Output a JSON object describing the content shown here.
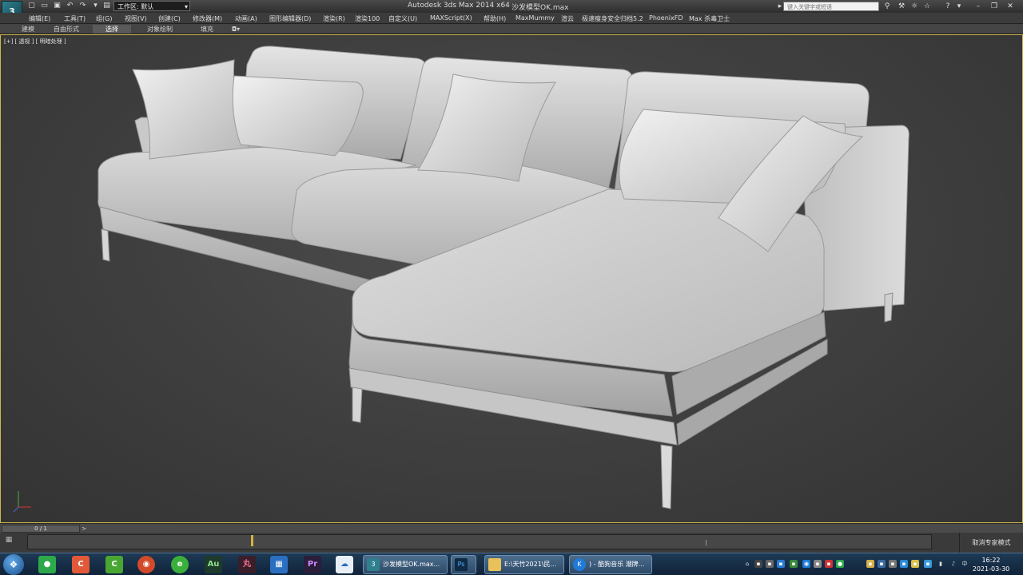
{
  "title_bar": {
    "logo": "3",
    "workspace_label": "工作区: 默认",
    "app_title": "Autodesk 3ds Max  2014 x64",
    "file_title": "沙发模型OK.max",
    "search_placeholder": "键入关键字或短语"
  },
  "menus": [
    "编辑(E)",
    "工具(T)",
    "组(G)",
    "视图(V)",
    "创建(C)",
    "修改器(M)",
    "动画(A)",
    "图形编辑器(D)",
    "渲染(R)",
    "渲染100",
    "自定义(U)",
    "MAXScript(X)",
    "帮助(H)",
    "MaxMummy",
    "渲云",
    "极速瘦身安全归档5.2",
    "PhoenixFD",
    "Max 杀毒卫士"
  ],
  "ribbon_tabs": [
    "建模",
    "自由形式",
    "选择",
    "对象绘制",
    "填充"
  ],
  "active_ribbon_tab": "选择",
  "viewport": {
    "label": "[+] [ 透视 ] [ 明暗处理 ]"
  },
  "timeline": {
    "frame_readout": "0 / 1",
    "next_icon": ">",
    "expert_mode_label": "取消专家模式"
  },
  "taskbar": {
    "tasks": [
      {
        "label": "沙发模型OK.max...",
        "icon": "3"
      },
      {
        "label": "",
        "icon": "Ps"
      },
      {
        "label": "E:\\天竹2021\\民...",
        "icon": "folder-icon"
      },
      {
        "label": ") - 酷狗音乐 潮牌...",
        "icon": "K"
      }
    ],
    "clock_time": "16:22",
    "clock_date": "2021-03-30"
  },
  "colors": {
    "viewport_border": "#cfb84a",
    "timeline_key": "#d3b23f",
    "taskbar": "#1e3a55"
  }
}
